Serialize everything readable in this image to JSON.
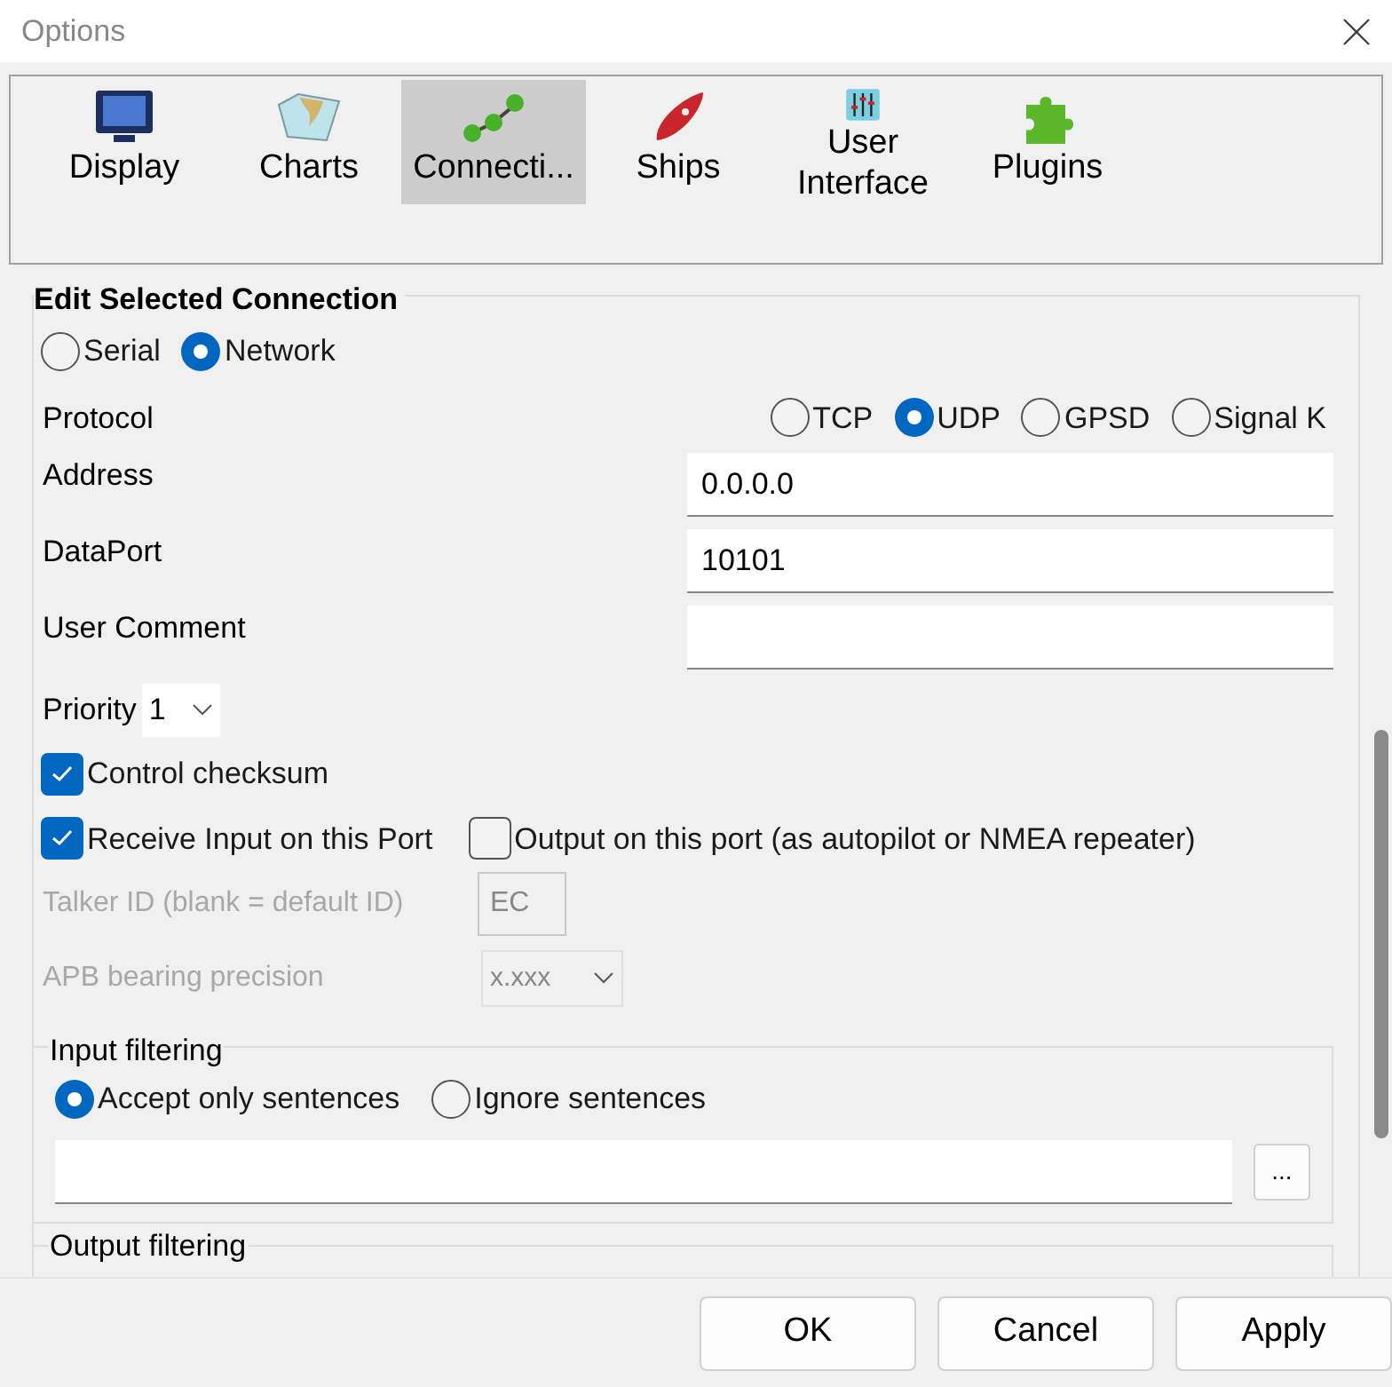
{
  "window": {
    "title": "Options"
  },
  "tabs": [
    {
      "label": "Display",
      "kind": "monitor",
      "selected": false
    },
    {
      "label": "Charts",
      "kind": "chart",
      "selected": false
    },
    {
      "label": "Connecti...",
      "kind": "nodes",
      "selected": true
    },
    {
      "label": "Ships",
      "kind": "ship",
      "selected": false
    },
    {
      "label": "User Interface",
      "kind": "sliders",
      "selected": false
    },
    {
      "label": "Plugins",
      "kind": "puzzle",
      "selected": false
    }
  ],
  "connection": {
    "title": "Edit Selected Connection",
    "types": [
      {
        "label": "Serial",
        "selected": false
      },
      {
        "label": "Network",
        "selected": true
      }
    ],
    "protocol": {
      "label": "Protocol",
      "options": [
        {
          "label": "TCP",
          "selected": false
        },
        {
          "label": "UDP",
          "selected": true
        },
        {
          "label": "GPSD",
          "selected": false
        },
        {
          "label": "Signal K",
          "selected": false
        }
      ]
    },
    "fields": [
      {
        "label": "Address",
        "value": "0.0.0.0"
      },
      {
        "label": "DataPort",
        "value": "10101"
      },
      {
        "label": "User Comment"
      }
    ],
    "priority": {
      "label": "Priority",
      "value": "1"
    },
    "control_checksum": {
      "label": "Control checksum",
      "checked": true
    },
    "receive_input": {
      "label": "Receive Input on this Port",
      "checked": true
    },
    "output": {
      "label": "Output on this port (as autopilot or NMEA repeater)",
      "checked": false
    },
    "talker_id": {
      "label": "Talker ID (blank = default ID)",
      "value": "EC",
      "disabled": true
    },
    "apb_precision": {
      "label": "APB bearing precision",
      "value": "x.xxx",
      "disabled": true
    },
    "input_filtering": {
      "title": "Input filtering",
      "options": [
        {
          "label": "Accept only sentences",
          "selected": true
        },
        {
          "label": "Ignore sentences",
          "selected": false
        }
      ],
      "browse": "..."
    },
    "output_filtering": {
      "title": "Output filtering"
    }
  },
  "buttons": [
    "OK",
    "Cancel",
    "Apply"
  ]
}
